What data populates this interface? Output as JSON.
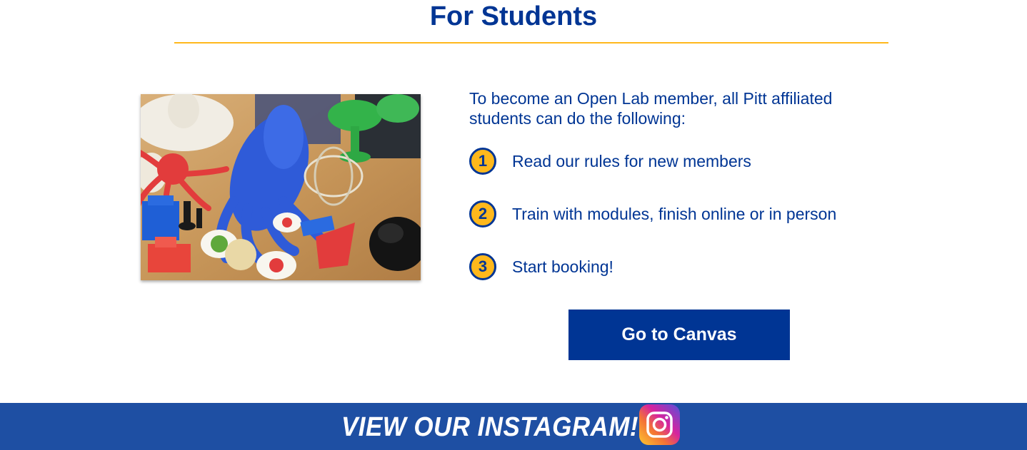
{
  "section": {
    "title": "For Students"
  },
  "photo": {
    "label": "3D printed objects on a table"
  },
  "intro": {
    "text": "To become an Open Lab member, all Pitt affiliated students can do the following:"
  },
  "steps": [
    {
      "number": "1",
      "label": "Read our rules for new members"
    },
    {
      "number": "2",
      "label": "Train with modules, finish online or in person"
    },
    {
      "number": "3",
      "label": "Start booking!"
    }
  ],
  "cta": {
    "label": "Go to Canvas"
  },
  "instagram": {
    "label": "VIEW OUR INSTAGRAM!",
    "icon": "instagram-icon"
  },
  "colors": {
    "brand_blue": "#003594",
    "accent_gold": "#FFB81C",
    "band_blue": "#1E4FA3"
  }
}
